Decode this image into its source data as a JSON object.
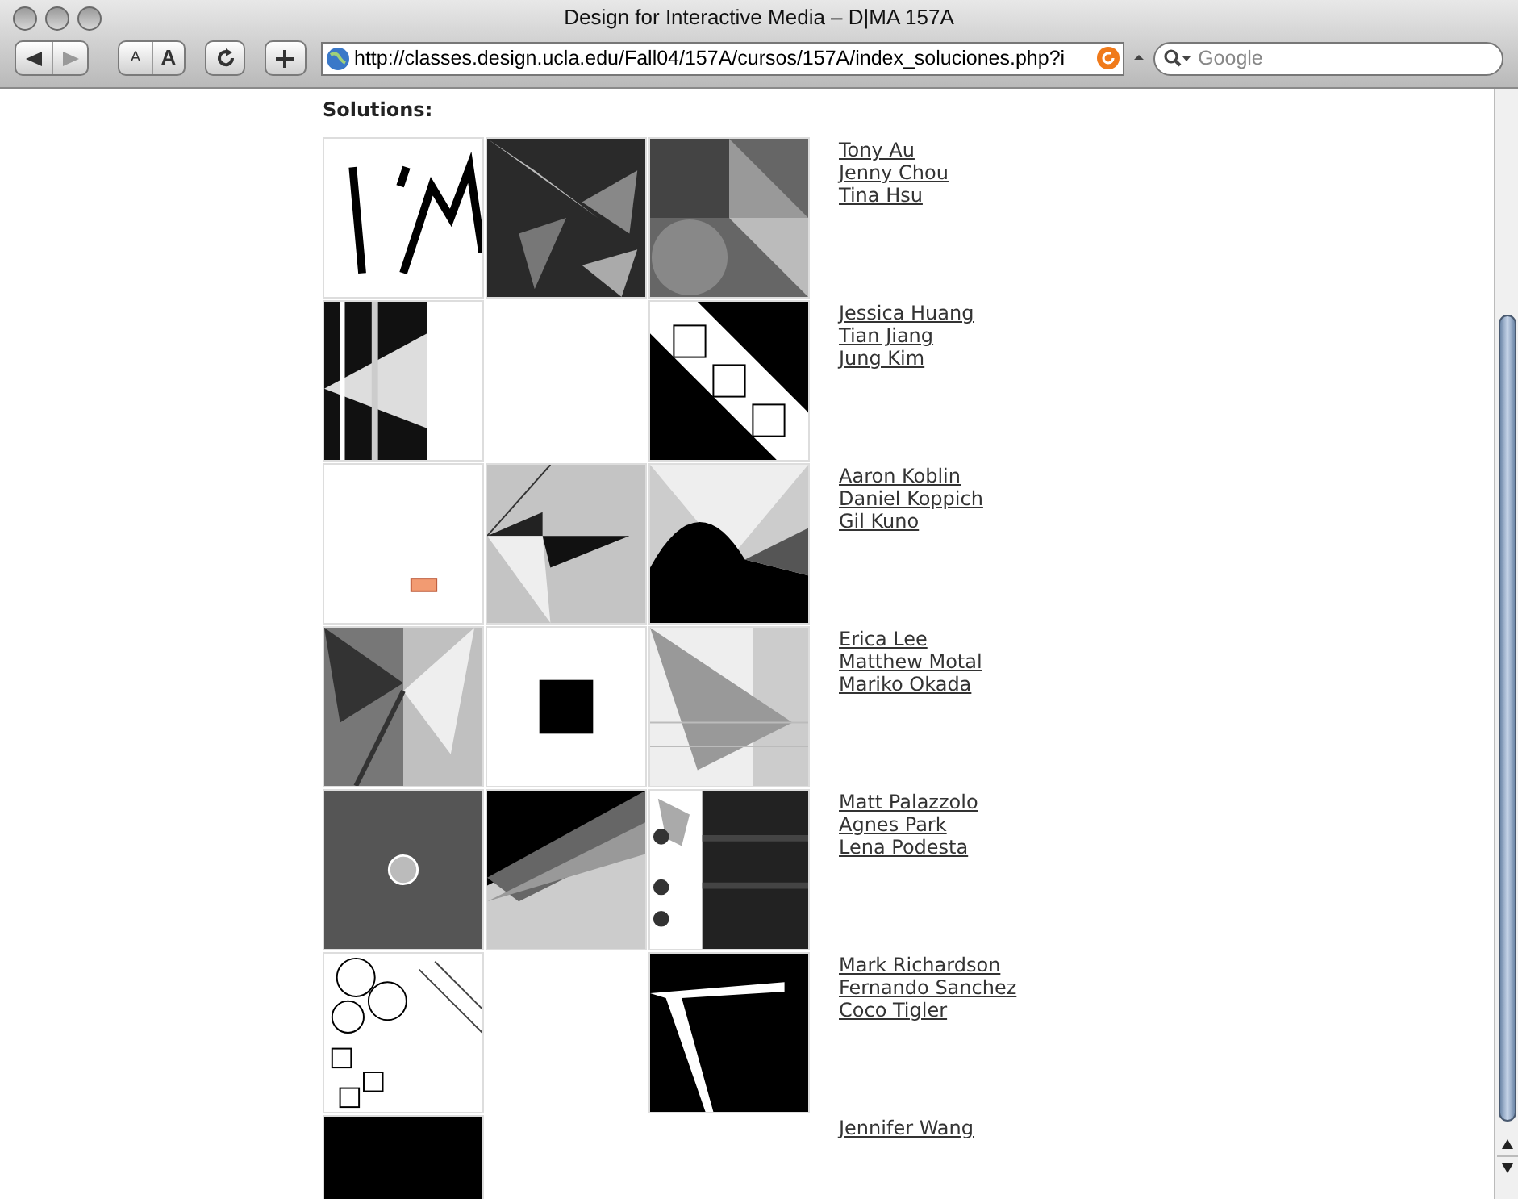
{
  "window": {
    "title": "Design for Interactive Media – D|MA 157A"
  },
  "toolbar": {
    "text_smaller": "A",
    "text_bigger": "A",
    "address": "http://classes.design.ucla.edu/Fall04/157A/cursos/157A/index_soluciones.php?i",
    "search_placeholder": "Google"
  },
  "heading": "Solutions:",
  "rows": [
    {
      "tiles": [
        {
          "kind": "picture"
        },
        {
          "kind": "picture"
        },
        {
          "kind": "picture"
        }
      ],
      "names": [
        "Tony Au",
        "Jenny Chou",
        "Tina Hsu"
      ]
    },
    {
      "tiles": [
        {
          "kind": "picture"
        },
        {
          "kind": "empty"
        },
        {
          "kind": "picture"
        }
      ],
      "names": [
        "Jessica Huang",
        "Tian Jiang",
        "Jung Kim"
      ]
    },
    {
      "tiles": [
        {
          "kind": "picture"
        },
        {
          "kind": "picture"
        },
        {
          "kind": "picture"
        }
      ],
      "names": [
        "Aaron Koblin",
        "Daniel Koppich",
        "Gil Kuno"
      ]
    },
    {
      "tiles": [
        {
          "kind": "picture"
        },
        {
          "kind": "picture"
        },
        {
          "kind": "picture"
        }
      ],
      "names": [
        "Erica Lee",
        "Matthew Motal",
        "Mariko Okada"
      ]
    },
    {
      "tiles": [
        {
          "kind": "picture"
        },
        {
          "kind": "picture"
        },
        {
          "kind": "picture"
        }
      ],
      "names": [
        "Matt Palazzolo",
        "Agnes Park",
        "Lena Podesta"
      ]
    },
    {
      "tiles": [
        {
          "kind": "picture"
        },
        {
          "kind": "empty"
        },
        {
          "kind": "picture"
        }
      ],
      "names": [
        "Mark Richardson",
        "Fernando Sanchez",
        "Coco Tigler"
      ]
    },
    {
      "tiles": [
        {
          "kind": "picture"
        },
        {
          "kind": "empty"
        },
        {
          "kind": "empty"
        }
      ],
      "names": [
        "Jennifer Wang"
      ]
    }
  ]
}
